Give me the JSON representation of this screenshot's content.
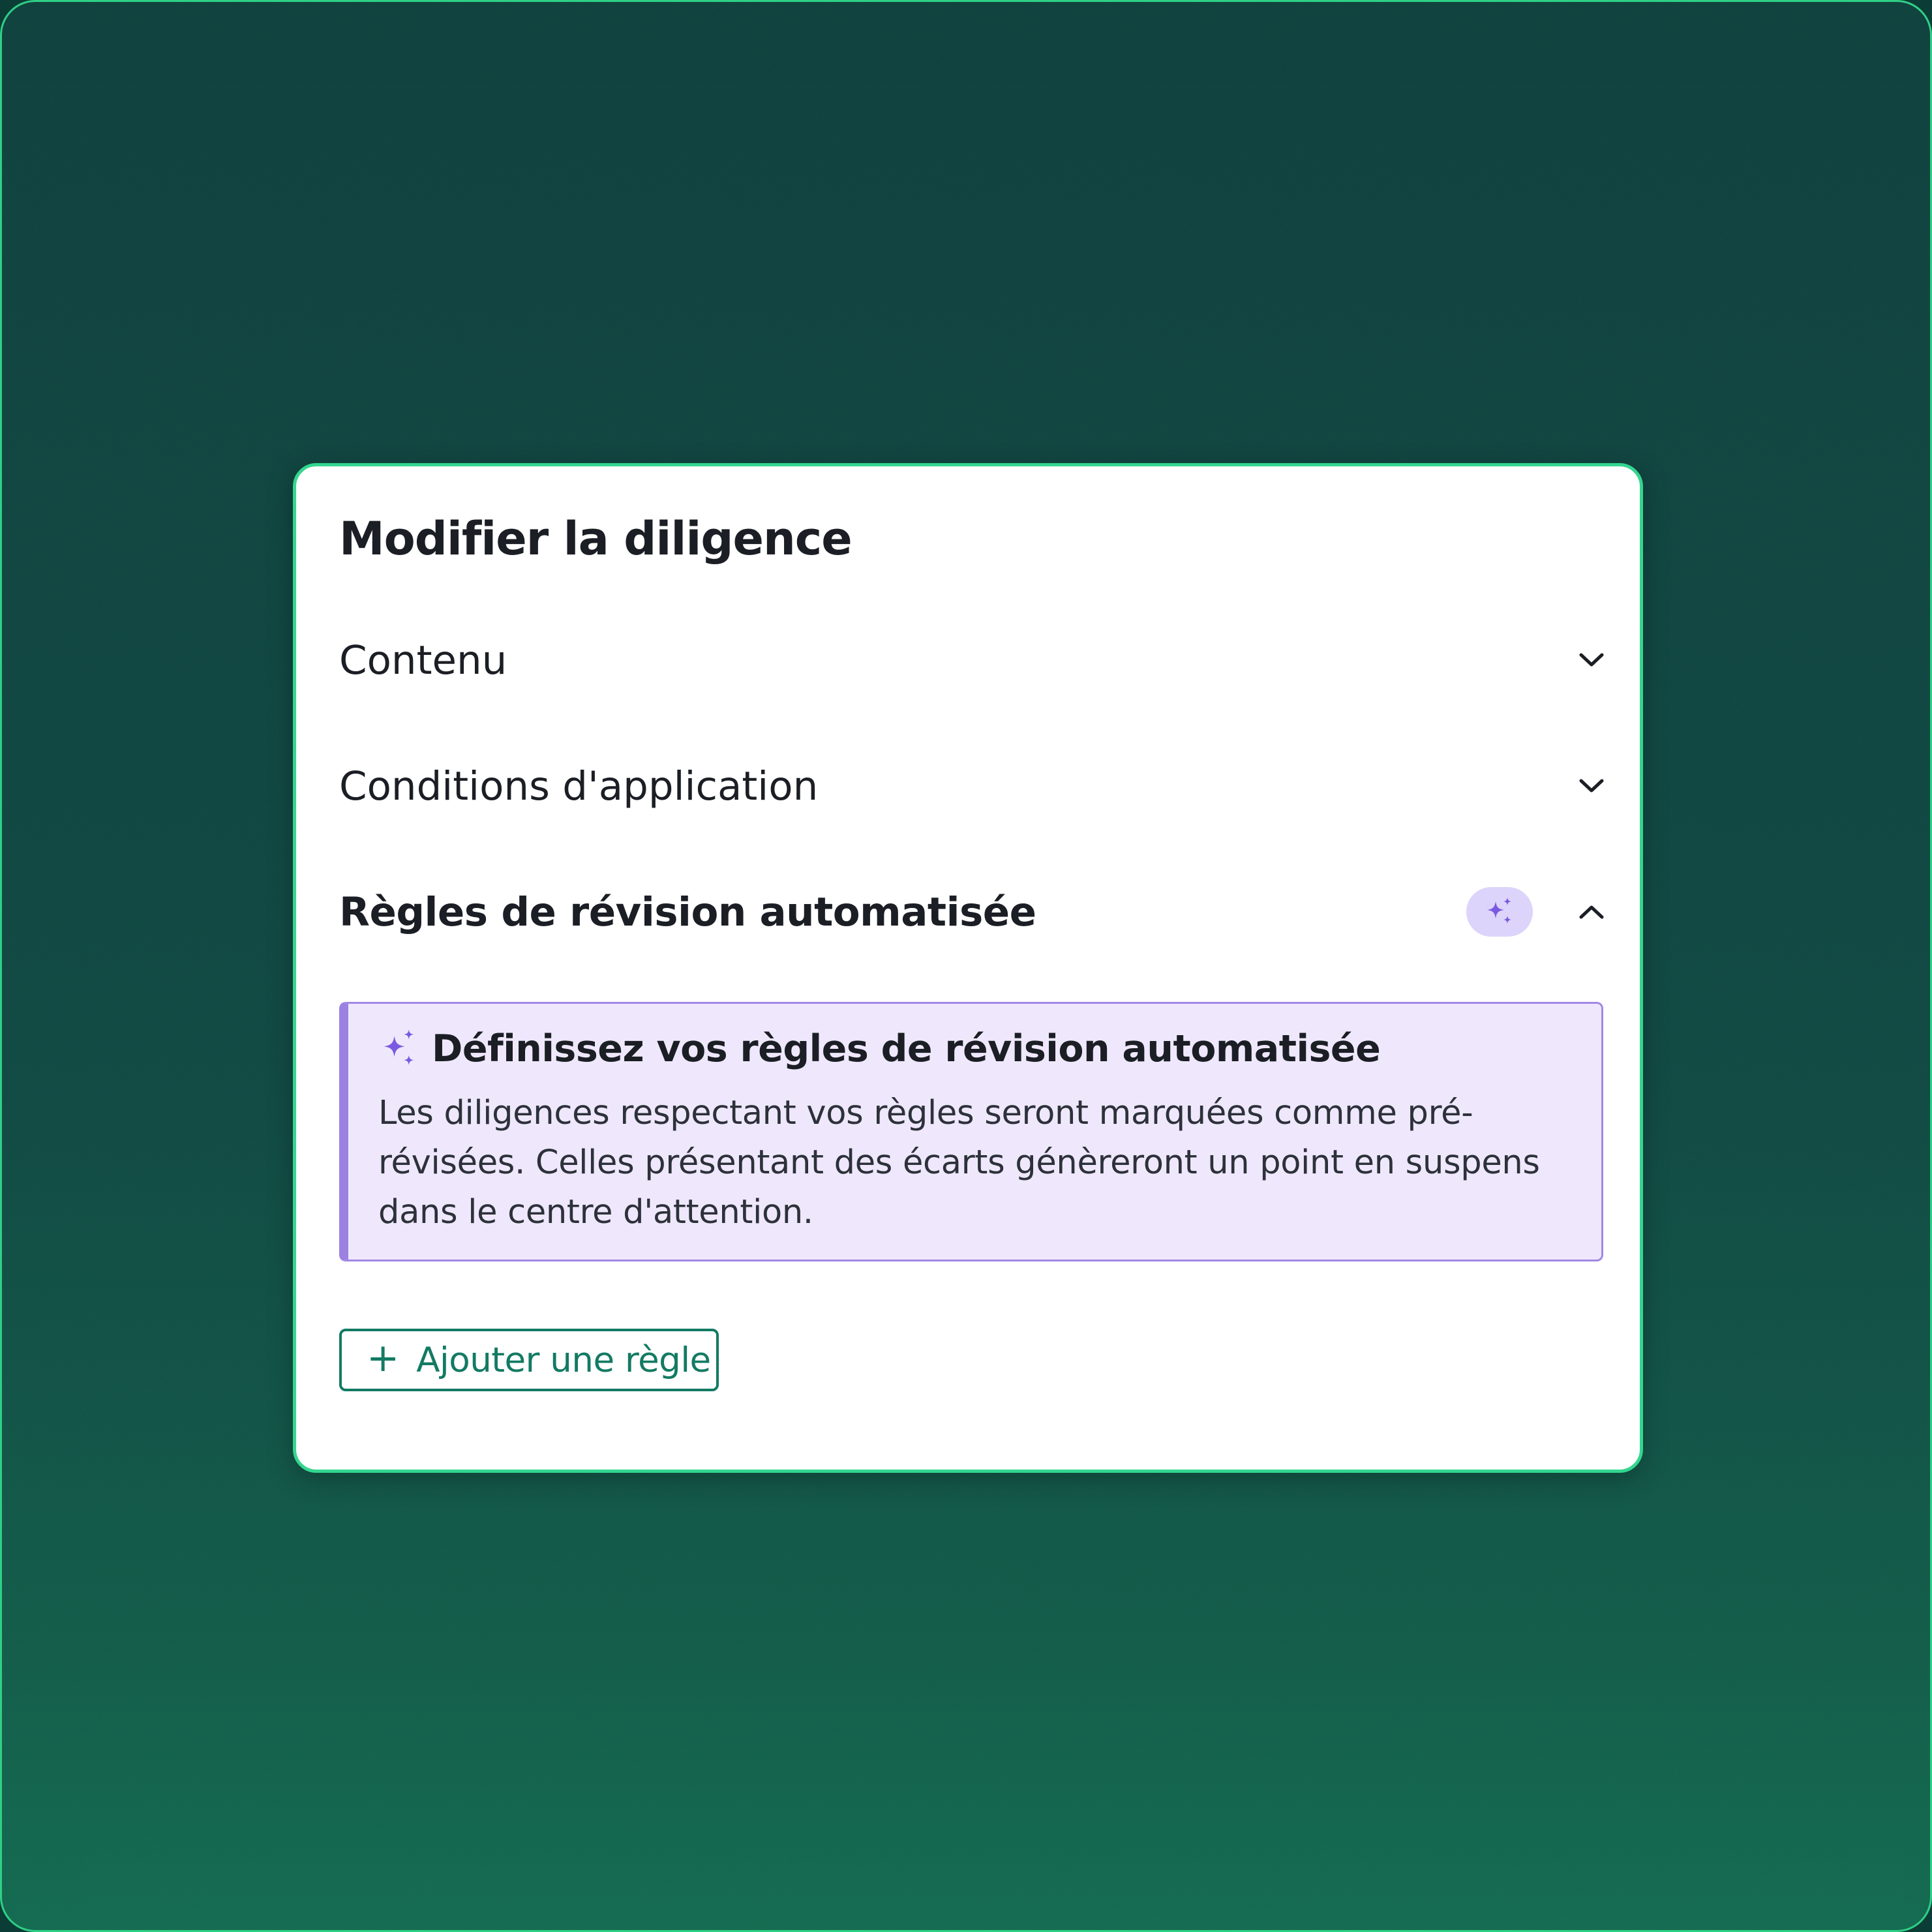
{
  "dialog": {
    "title": "Modifier la diligence"
  },
  "sections": [
    {
      "label": "Contenu",
      "expanded": false,
      "icon": "chevron-down-icon"
    },
    {
      "label": "Conditions d'application",
      "expanded": false,
      "icon": "chevron-down-icon"
    },
    {
      "label": "Règles de révision automatisée",
      "expanded": true,
      "icon": "chevron-up-icon",
      "badge_icon": "sparkles-icon"
    }
  ],
  "callout": {
    "icon": "sparkles-icon",
    "title": "Définissez vos règles de révision automatisée",
    "body": "Les diligences respectant vos règles seront marquées comme pré-révisées. Celles présentant des écarts génèreront un point en suspens dans le centre d'attention."
  },
  "actions": {
    "add_rule_icon": "plus-icon",
    "add_rule_label": "Ajouter une règle"
  },
  "colors": {
    "background": "#0b3f3b",
    "frame_border": "#2fcf86",
    "card_border": "#34d690",
    "accent_purple": "#7a5ae0",
    "callout_bg": "#efe8fd",
    "callout_border": "#a188e6",
    "badge_bg": "#ddd4fb",
    "button_green": "#137a63",
    "text": "#1b1e24"
  }
}
